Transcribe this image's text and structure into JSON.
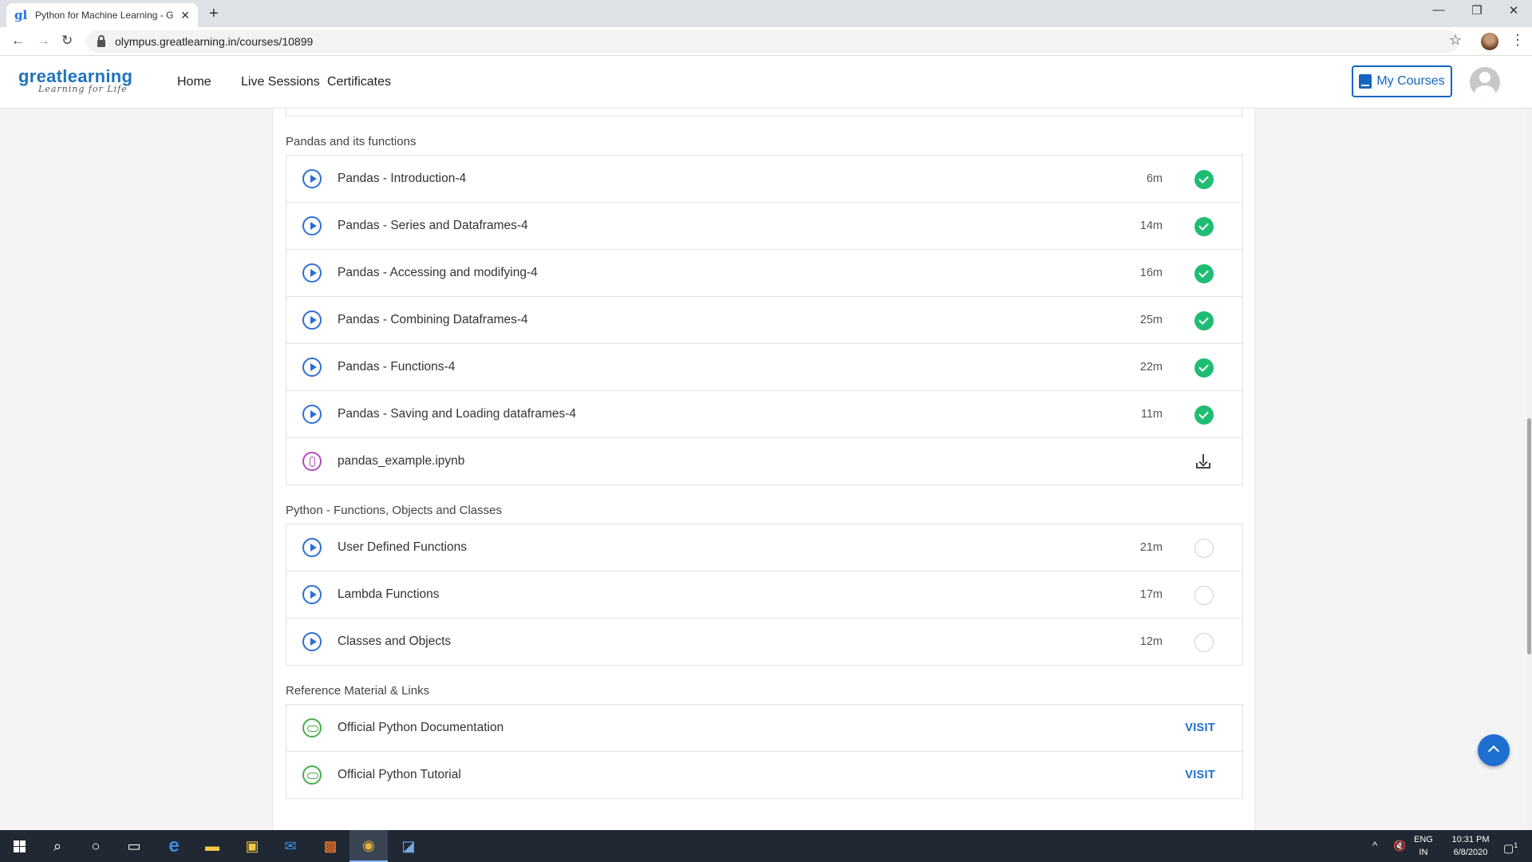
{
  "browser": {
    "tab_title": "Python for Machine Learning - G",
    "tab_close": "✕",
    "new_tab": "+",
    "url": "olympus.greatlearning.in/courses/10899",
    "minimize": "—",
    "maximize": "❐",
    "close": "✕"
  },
  "site": {
    "logo_main": "greatlearning",
    "logo_sub": "Learning for Life",
    "nav": [
      "Home",
      "Live Sessions",
      "Certificates"
    ],
    "my_courses": "My Courses"
  },
  "sections": [
    {
      "title": "Pandas and its functions",
      "items": [
        {
          "type": "video",
          "title": "Pandas - Introduction-4",
          "duration": "6m",
          "status": "completed"
        },
        {
          "type": "video",
          "title": "Pandas - Series and Dataframes-4",
          "duration": "14m",
          "status": "completed"
        },
        {
          "type": "video",
          "title": "Pandas - Accessing and modifying-4",
          "duration": "16m",
          "status": "completed"
        },
        {
          "type": "video",
          "title": "Pandas - Combining Dataframes-4",
          "duration": "25m",
          "status": "completed"
        },
        {
          "type": "video",
          "title": "Pandas - Functions-4",
          "duration": "22m",
          "status": "completed"
        },
        {
          "type": "video",
          "title": "Pandas - Saving and Loading dataframes-4",
          "duration": "11m",
          "status": "completed"
        },
        {
          "type": "file",
          "title": "pandas_example.ipynb"
        }
      ]
    },
    {
      "title": "Python - Functions, Objects and Classes",
      "items": [
        {
          "type": "video",
          "title": "User Defined Functions",
          "duration": "21m",
          "status": "not-started"
        },
        {
          "type": "video",
          "title": "Lambda Functions",
          "duration": "17m",
          "status": "not-started"
        },
        {
          "type": "video",
          "title": "Classes and Objects",
          "duration": "12m",
          "status": "not-started"
        }
      ]
    },
    {
      "title": "Reference Material & Links",
      "items": [
        {
          "type": "link",
          "title": "Official Python Documentation",
          "action": "VISIT"
        },
        {
          "type": "link",
          "title": "Official Python Tutorial",
          "action": "VISIT"
        }
      ]
    }
  ],
  "taskbar": {
    "lang_top": "ENG",
    "lang_bottom": "IN",
    "time": "10:31 PM",
    "date": "6/8/2020",
    "notification_count": "1"
  },
  "colors": {
    "accent": "#1e6fd0",
    "complete": "#1fbd73",
    "video_icon": "#2f6fd3",
    "file_icon": "#b04cbc",
    "link_icon": "#46b04a"
  }
}
